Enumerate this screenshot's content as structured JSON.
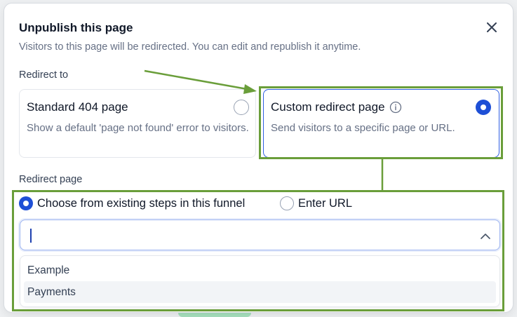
{
  "modal": {
    "title": "Unpublish this page",
    "subtitle": "Visitors to this page will be redirected. You can edit and republish it anytime.",
    "close_icon": "close-icon"
  },
  "redirect_to": {
    "label": "Redirect to",
    "options": [
      {
        "title": "Standard 404 page",
        "description": "Show a default 'page not found' error to visitors.",
        "selected": false
      },
      {
        "title": "Custom redirect page",
        "description": "Send visitors to a specific page or URL.",
        "selected": true,
        "icon": "info-icon"
      }
    ]
  },
  "redirect_page": {
    "label": "Redirect page",
    "modes": [
      {
        "label": "Choose from existing steps in this funnel",
        "selected": true
      },
      {
        "label": "Enter URL",
        "selected": false
      }
    ],
    "select": {
      "value": "",
      "expanded": true,
      "icon": "chevron-up-icon"
    },
    "dropdown_options": [
      "Example",
      "Payments"
    ],
    "hovered_option": "Payments"
  },
  "colors": {
    "accent": "#1e4fd6",
    "annotation": "#6a9e3a",
    "muted_text": "#667085"
  }
}
